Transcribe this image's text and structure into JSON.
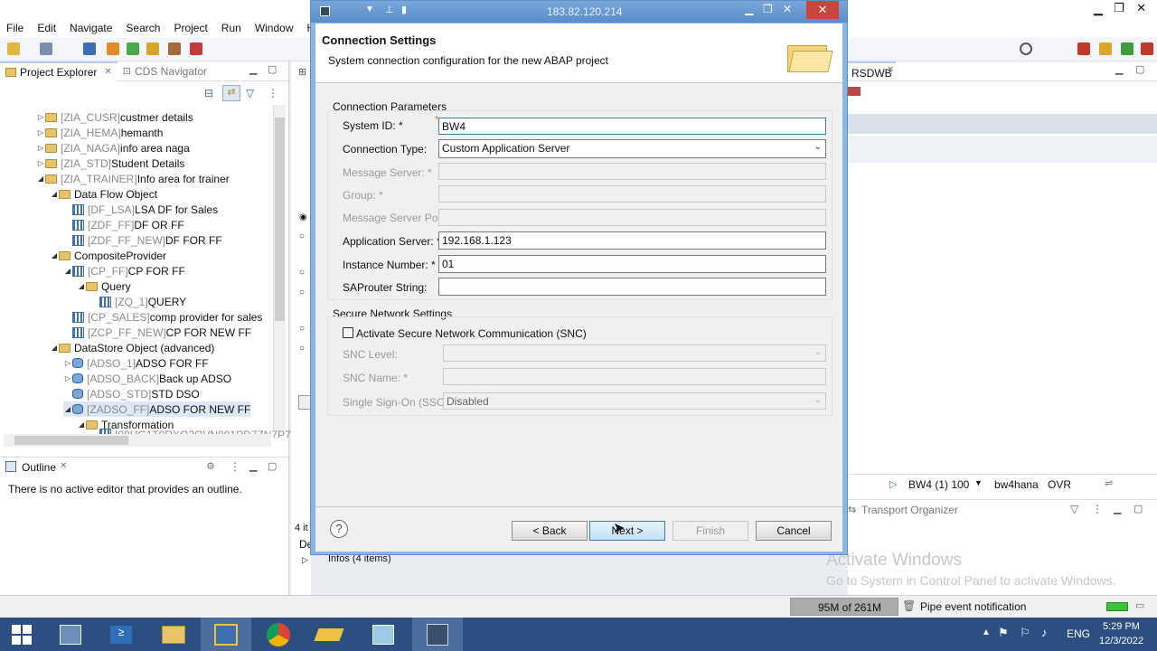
{
  "menu": [
    "File",
    "Edit",
    "Navigate",
    "Search",
    "Project",
    "Run",
    "Window",
    "Help"
  ],
  "left_panel": {
    "tabs": [
      "Project Explorer",
      "CDS Navigator"
    ],
    "tree": [
      {
        "tech": "[ZIA_CUSR]",
        "label": "custmer details"
      },
      {
        "tech": "[ZIA_HEMA]",
        "label": "hemanth"
      },
      {
        "tech": "[ZIA_NAGA]",
        "label": "info area  naga"
      },
      {
        "tech": "[ZIA_STD]",
        "label": "Student Details"
      },
      {
        "tech": "[ZIA_TRAINER]",
        "label": "Info area for trainer"
      },
      {
        "tech": "",
        "label": "Data Flow Object"
      },
      {
        "tech": "[DF_LSA]",
        "label": "LSA DF for Sales"
      },
      {
        "tech": "[ZDF_FF]",
        "label": "DF OR FF"
      },
      {
        "tech": "[ZDF_FF_NEW]",
        "label": "DF FOR FF"
      },
      {
        "tech": "",
        "label": "CompositeProvider"
      },
      {
        "tech": "[CP_FF]",
        "label": "CP FOR FF"
      },
      {
        "tech": "",
        "label": "Query"
      },
      {
        "tech": "[ZQ_1]",
        "label": "QUERY"
      },
      {
        "tech": "[CP_SALES]",
        "label": "comp provider for sales"
      },
      {
        "tech": "[ZCP_FF_NEW]",
        "label": "CP FOR NEW FF"
      },
      {
        "tech": "",
        "label": "DataStore Object (advanced)"
      },
      {
        "tech": "[ADSO_1]",
        "label": "ADSO FOR FF"
      },
      {
        "tech": "[ADSO_BACK]",
        "label": "Back up ADSO"
      },
      {
        "tech": "[ADSO_STD]",
        "label": "STD DSO"
      },
      {
        "tech": "[ZADSO_FF]",
        "label": "ADSO FOR NEW FF"
      },
      {
        "tech": "",
        "label": "Transformation"
      },
      {
        "tech": "[08HG1T9RXO2OVN891PD7ZN7P7",
        "label": ""
      }
    ],
    "outline_tab": "Outline",
    "outline_msg": "There is no active editor that provides an outline."
  },
  "right_side": {
    "tab": "RSDWB",
    "status_system": "BW4 (1) 100",
    "status_host": "bw4hana",
    "status_mode": "OVR",
    "transport": "Transport Organizer",
    "watermark_title": "Activate Windows",
    "watermark_sub": "Go to System in Control Panel to activate Windows."
  },
  "background_fragments": {
    "items": "4 it",
    "de": "De",
    "infos": "Infos (4 items)"
  },
  "dialog": {
    "window_ip": "183.82.120.214",
    "title": "Connection Settings",
    "subtitle": "System connection configuration for the new ABAP project",
    "group1": "Connection Parameters",
    "fields": {
      "system_id": {
        "label": "System ID: *",
        "value": "BW4"
      },
      "conn_type": {
        "label": "Connection Type:",
        "value": "Custom Application Server"
      },
      "msg_server": {
        "label": "Message Server: *",
        "value": ""
      },
      "group": {
        "label": "Group: *",
        "value": ""
      },
      "msg_port": {
        "label": "Message Server Port:",
        "value": ""
      },
      "app_server": {
        "label": "Application Server: *",
        "value": "192.168.1.123"
      },
      "instance": {
        "label": "Instance Number: *",
        "value": "01"
      },
      "saprouter": {
        "label": "SAProuter String:",
        "value": ""
      }
    },
    "group2": "Secure Network Settings",
    "snc_checkbox": "Activate Secure Network Communication (SNC)",
    "snc_level": {
      "label": "SNC Level:",
      "value": ""
    },
    "snc_name": {
      "label": "SNC Name: *",
      "value": ""
    },
    "sso": {
      "label": "Single Sign-On (SSO):",
      "value": "Disabled"
    },
    "buttons": {
      "back": "< Back",
      "next": "Next >",
      "finish": "Finish",
      "cancel": "Cancel"
    }
  },
  "statusbar": {
    "memory": "95M of 261M",
    "event": "Pipe event notification"
  },
  "taskbar": {
    "lang": "ENG",
    "time": "5:29 PM",
    "date": "12/3/2022"
  }
}
